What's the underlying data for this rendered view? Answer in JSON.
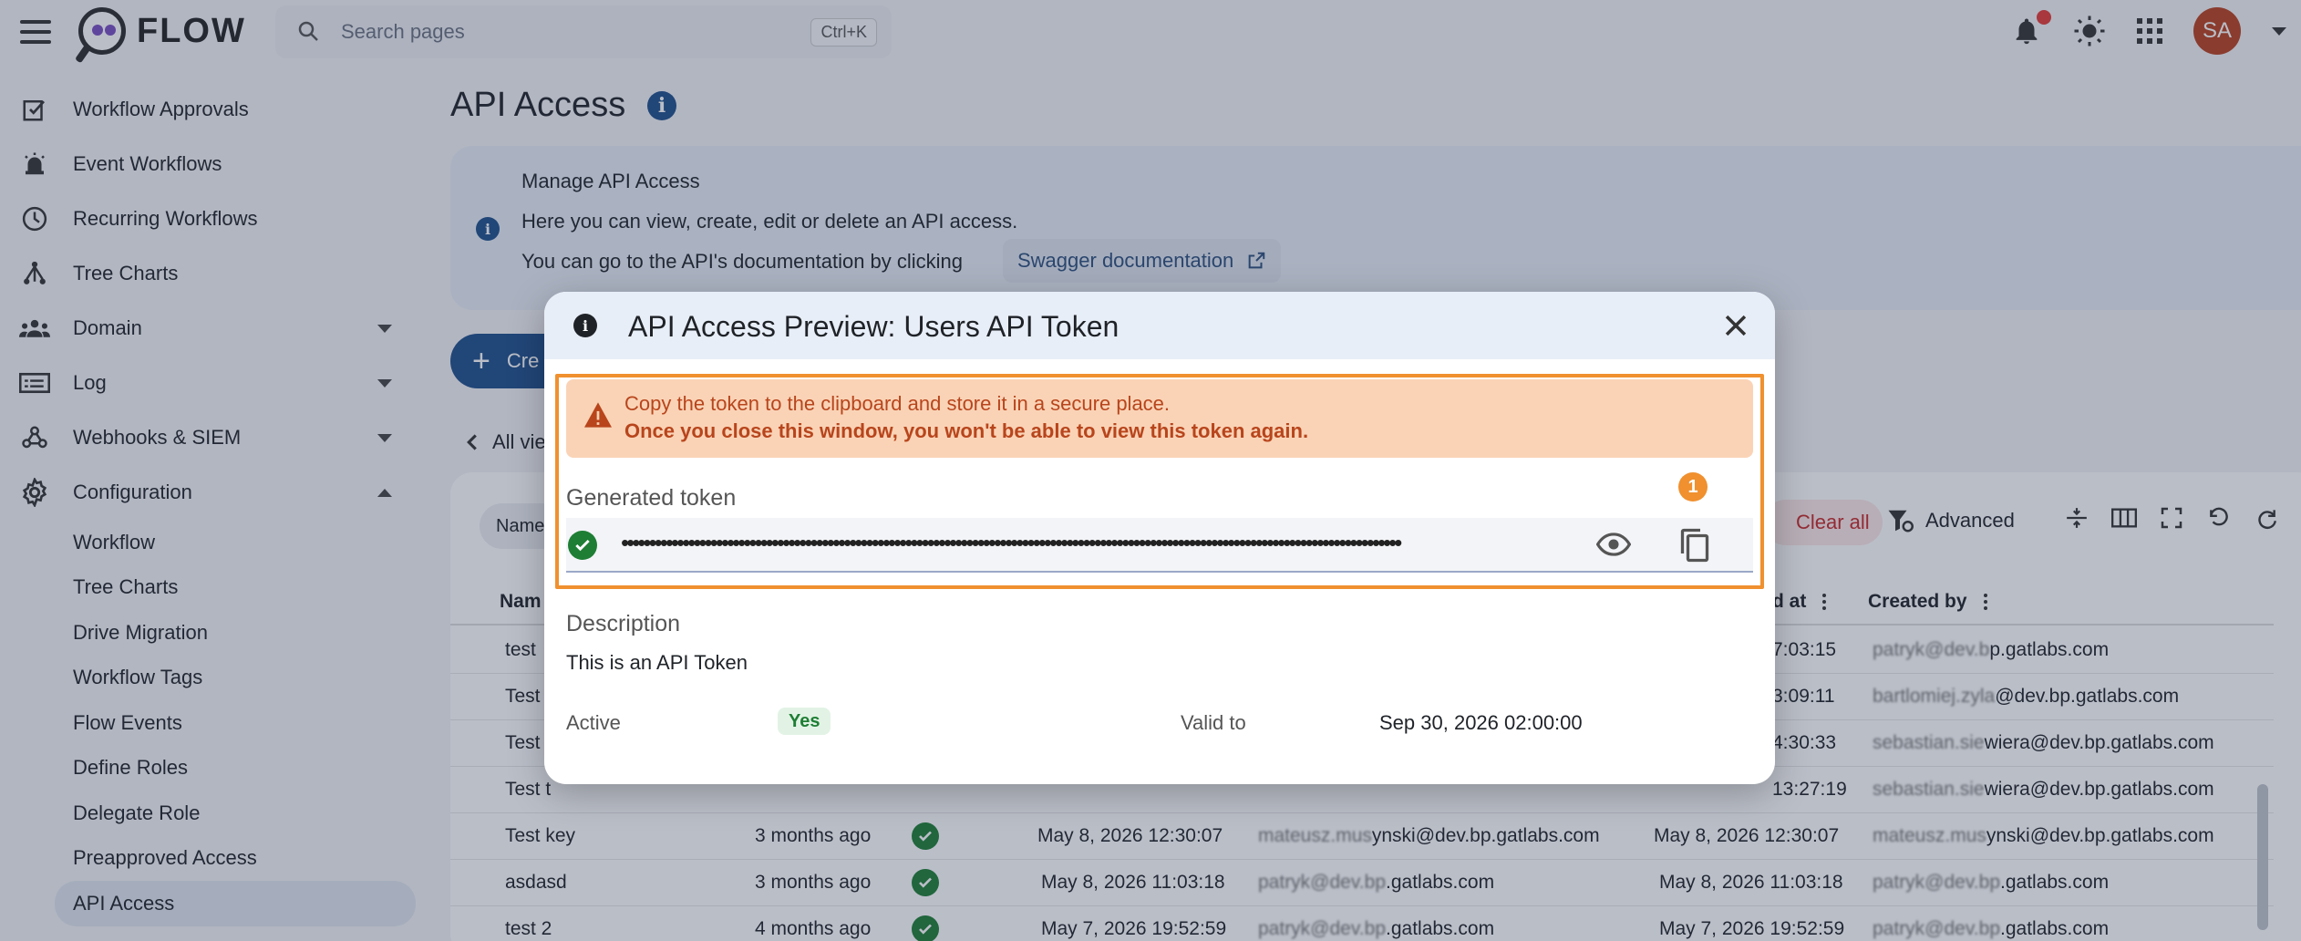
{
  "app": {
    "name": "FLOW"
  },
  "search": {
    "placeholder": "Search pages",
    "shortcut": "Ctrl+K"
  },
  "user": {
    "initials": "SA"
  },
  "sidebar": {
    "items": [
      {
        "label": "Workflow Approvals",
        "icon": "approvals-icon"
      },
      {
        "label": "Event Workflows",
        "icon": "alarm-icon"
      },
      {
        "label": "Recurring Workflows",
        "icon": "clock-icon"
      },
      {
        "label": "Tree Charts",
        "icon": "tree-icon"
      },
      {
        "label": "Domain",
        "icon": "people-icon",
        "expandable": true
      },
      {
        "label": "Log",
        "icon": "log-icon",
        "expandable": true
      },
      {
        "label": "Webhooks & SIEM",
        "icon": "webhook-icon",
        "expandable": true
      },
      {
        "label": "Configuration",
        "icon": "gear-icon",
        "expanded": true
      }
    ],
    "sub_items": [
      "Workflow",
      "Tree Charts",
      "Drive Migration",
      "Workflow Tags",
      "Flow Events",
      "Define Roles",
      "Delegate Role",
      "Preapproved Access",
      "API Access"
    ],
    "active_sub_item": "API Access"
  },
  "page": {
    "title": "API Access",
    "info_title": "Manage API Access",
    "info_line1": "Here you can view, create, edit or delete an API access.",
    "info_line2": "You can go to the API's documentation by clicking",
    "swagger_label": "Swagger documentation",
    "create_label": "Cre",
    "all_views_label": "All vie"
  },
  "table": {
    "filter_chip": "Name",
    "clear_all": "Clear all",
    "advanced": "Advanced",
    "headers": {
      "name": "Nam",
      "updated_at": "d at",
      "created_by": "Created by"
    },
    "rows": [
      {
        "name": "test",
        "updated_at": "7:03:15",
        "created_by_a": "patryk@dev.b",
        "created_by_b": "p.gatlabs.com"
      },
      {
        "name": "Test",
        "updated_at": "3:09:11",
        "created_by_a": "bartlomiej.zyla",
        "created_by_b": "@dev.bp.gatlabs.com"
      },
      {
        "name": "Test",
        "updated_at": "4:30:33",
        "created_by_a": "sebastian.sie",
        "created_by_b": "wiera@dev.bp.gatlabs.com"
      },
      {
        "name": "Test t",
        "updated_at": "13:27:19",
        "created_by_a": "sebastian.sie",
        "created_by_b": "wiera@dev.bp.gatlabs.com"
      },
      {
        "name": "Test key",
        "age": "3 months ago",
        "modified": "May 8, 2026 12:30:07",
        "mod_by_a": "mateusz.mus",
        "mod_by_b": "ynski@dev.bp.gatlabs.com",
        "updated_at": "May 8, 2026 12:30:07",
        "created_by_a": "mateusz.mus",
        "created_by_b": "ynski@dev.bp.gatlabs.com"
      },
      {
        "name": "asdasd",
        "age": "3 months ago",
        "modified": "May 8, 2026 11:03:18",
        "mod_by_a": "patryk@dev.bp",
        "mod_by_b": ".gatlabs.com",
        "updated_at": "May 8, 2026 11:03:18",
        "created_by_a": "patryk@dev.bp",
        "created_by_b": ".gatlabs.com"
      },
      {
        "name": "test 2",
        "age": "4 months ago",
        "modified": "May 7, 2026 19:52:59",
        "mod_by_a": "patryk@dev.bp",
        "mod_by_b": ".gatlabs.com",
        "updated_at": "May 7, 2026 19:52:59",
        "created_by_a": "patryk@dev.bp",
        "created_by_b": ".gatlabs.com"
      }
    ]
  },
  "modal": {
    "title": "API Access Preview: Users API Token",
    "warning_line1": "Copy the token to the clipboard and store it in a secure place.",
    "warning_line2": "Once you close this window, you won't be able to view this token again.",
    "generated_token_label": "Generated token",
    "badge": "1",
    "token_masked": "••••••••••••••••••••••••••••••••••••••••••••••••••••••••••••••••••••••••••••••••••••••••••••••••••••••••••••••••••••••••••••••••••••••••••••",
    "description_label": "Description",
    "description_value": "This is an API Token",
    "active_label": "Active",
    "active_value": "Yes",
    "valid_to_label": "Valid to",
    "valid_to_value": "Sep 30, 2026 02:00:00"
  },
  "colors": {
    "primary": "#1e4f8b",
    "accent": "#f0902e",
    "warning_bg": "#fad3b6",
    "warning_text": "#b8451c",
    "success": "#1e7e34"
  }
}
